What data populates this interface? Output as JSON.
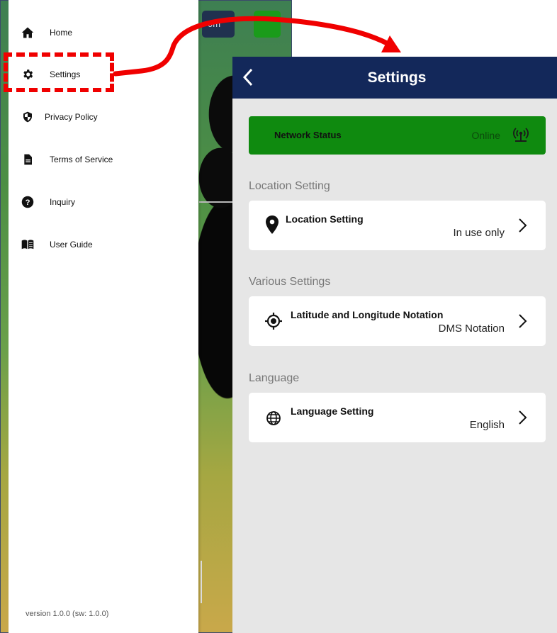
{
  "drawer": {
    "items": [
      {
        "label": "Home",
        "icon": "home-icon"
      },
      {
        "label": "Settings",
        "icon": "gear-icon"
      },
      {
        "label": "Privacy Policy",
        "icon": "shield-icon"
      },
      {
        "label": "Terms of Service",
        "icon": "document-icon"
      },
      {
        "label": "Inquiry",
        "icon": "question-icon"
      },
      {
        "label": "User Guide",
        "icon": "book-icon"
      }
    ],
    "version": "version 1.0.0 (sw:  1.0.0)"
  },
  "map": {
    "chip_label": "0m"
  },
  "settings": {
    "title": "Settings",
    "network": {
      "label": "Network Status",
      "status": "Online",
      "icon": "broadcast-icon"
    },
    "sections": [
      {
        "header": "Location Setting",
        "card": {
          "title": "Location Setting",
          "value": "In use only",
          "icon": "location-pin-icon"
        }
      },
      {
        "header": "Various Settings",
        "card": {
          "title": "Latitude and Longitude Notation",
          "value": "DMS Notation",
          "icon": "crosshair-icon"
        }
      },
      {
        "header": "Language",
        "card": {
          "title": "Language Setting",
          "value": "English",
          "icon": "globe-icon"
        }
      }
    ]
  },
  "colors": {
    "topbar": "#13285a",
    "network_bg": "#0f8a0f",
    "annotation": "#f00000"
  }
}
